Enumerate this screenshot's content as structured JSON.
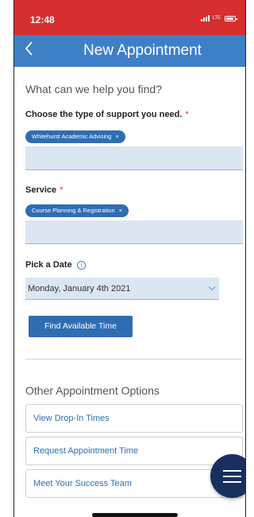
{
  "status_bar": {
    "time": "12:48",
    "network": "LTE"
  },
  "nav": {
    "title": "New Appointment",
    "back_icon": "chevron-left-icon"
  },
  "help_heading": "What can we help you find?",
  "support_type": {
    "label": "Choose the type of support you need.",
    "required_mark": "*",
    "chip_label": "Whitehurst Academic Advising",
    "chip_remove": "×",
    "input_value": ""
  },
  "service": {
    "label": "Service",
    "required_mark": "*",
    "chip_label": "Course Planning & Registration",
    "chip_remove": "×",
    "input_value": ""
  },
  "date": {
    "label": "Pick a Date",
    "info_icon": "ⓘ",
    "selected": "Monday, January 4th 2021"
  },
  "find_button_label": "Find Available Time",
  "other_options": {
    "heading": "Other Appointment Options",
    "items": [
      {
        "label": "View Drop-In Times"
      },
      {
        "label": "Request Appointment Time"
      },
      {
        "label": "Meet Your Success Team"
      }
    ]
  },
  "colors": {
    "status_bar": "#d62f2f",
    "nav_bar": "#3e80c8",
    "accent": "#2f6db3",
    "fab": "#17305e"
  }
}
